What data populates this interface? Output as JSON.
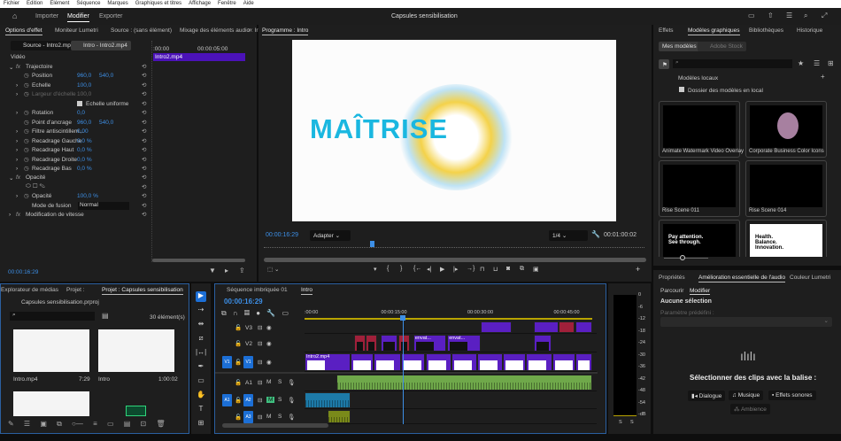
{
  "menu": [
    "Fichier",
    "Edition",
    "Elément",
    "Séquence",
    "Marques",
    "Graphiques et titres",
    "Affichage",
    "Fenêtre",
    "Aide"
  ],
  "header": {
    "home_icon": "home-icon",
    "workspaces": [
      "Importer",
      "Modifier",
      "Exporter"
    ],
    "active": "Modifier",
    "title": "Capsules sensibilisation",
    "right_icons": [
      "workspace-panel-icon",
      "share-icon",
      "menu-icon",
      "search-icon",
      "fullscreen-icon"
    ]
  },
  "effects": {
    "tabs": [
      "Options d'effet",
      "Moniteur Lumetri",
      "Source : (sans élément)",
      "Mixage des éléments audio : Ir"
    ],
    "source_tab": "Source - Intro2.mp4",
    "seq_tab": "Intro - Intro2.mp4",
    "section": "Vidéo",
    "ruler": [
      ":00:00",
      "00:00:05:00"
    ],
    "clip": "Intro2.mp4",
    "rows": [
      {
        "label": "Trajectoire",
        "fx": true,
        "open": true,
        "v": []
      },
      {
        "label": "Position",
        "sw": true,
        "v": [
          "960,0",
          "540,0"
        ]
      },
      {
        "label": "Echelle",
        "sw": true,
        "exp": true,
        "v": [
          "100,0"
        ]
      },
      {
        "label": "Largeur d'échelle",
        "sw": true,
        "exp": true,
        "dis": true,
        "v": [
          "100,0"
        ]
      },
      {
        "label": "Echelle uniforme",
        "check": true,
        "v": []
      },
      {
        "label": "Rotation",
        "sw": true,
        "exp": true,
        "v": [
          "0,0"
        ]
      },
      {
        "label": "Point d'ancrage",
        "sw": true,
        "v": [
          "960,0",
          "540,0"
        ]
      },
      {
        "label": "Filtre antiscintillem...",
        "sw": true,
        "exp": true,
        "v": [
          "0,00"
        ]
      },
      {
        "label": "Recadrage Gauche",
        "sw": true,
        "exp": true,
        "v": [
          "0,0 %"
        ]
      },
      {
        "label": "Recadrage Haut",
        "sw": true,
        "exp": true,
        "v": [
          "0,0 %"
        ]
      },
      {
        "label": "Recadrage Droite",
        "sw": true,
        "exp": true,
        "v": [
          "0,0 %"
        ]
      },
      {
        "label": "Recadrage Bas",
        "sw": true,
        "exp": true,
        "v": [
          "0,0 %"
        ]
      },
      {
        "label": "Opacité",
        "fx": true,
        "open": true,
        "v": []
      },
      {
        "label": "",
        "masks": true,
        "v": []
      },
      {
        "label": "Opacité",
        "sw": true,
        "exp": true,
        "v": [
          "100,0 %"
        ]
      },
      {
        "label": "Mode de fusion",
        "select": "Normal",
        "v": []
      },
      {
        "label": "Modification de vitesse",
        "fx": true,
        "v": []
      }
    ],
    "timecode": "00:00:16:29"
  },
  "program": {
    "tab": "Programme : Intro",
    "title_text": "MAÎTRISE",
    "title_color": "#1ab7e0",
    "timecode": "00:00:16:29",
    "fit": "Adapter",
    "resolution": "1/4",
    "duration": "00:01:00:02",
    "playhead_fraction": 0.28,
    "buttons": [
      "marker-icon",
      "mark-in-icon",
      "mark-out-icon",
      "go-to-in-icon",
      "step-back-icon",
      "play-icon",
      "step-forward-icon",
      "go-to-out-icon",
      "insert-icon",
      "overwrite-icon",
      "export-frame-icon",
      "compare-icon",
      "proxy-icon"
    ]
  },
  "graphics": {
    "tabs": [
      "Effets",
      "Modèles graphiques",
      "Bibliothèques",
      "Historique"
    ],
    "sub": [
      "Mes modèles",
      "Adobe Stock"
    ],
    "local": "Modèles locaux",
    "folder": "Dossier des modèles en local",
    "cards": [
      {
        "label": "Animate Watermark Video Overlay"
      },
      {
        "label": "Corporate Business Color Icons"
      },
      {
        "label": "Rise Scene 011"
      },
      {
        "label": "Rise Scene 014"
      },
      {
        "label": "",
        "text": "Pay attention. See through."
      },
      {
        "label": "",
        "text": "Health. Balance. Innovation."
      }
    ]
  },
  "project": {
    "tabs": [
      "Explorateur de médias",
      "Projet :",
      "Projet : Capsules sensibilisation"
    ],
    "file": "Capsules sensibilisation.prproj",
    "count": "30 élément(s)",
    "items": [
      {
        "name": "Intro.mp4",
        "dur": "7:29"
      },
      {
        "name": "Intro",
        "dur": "1:00:02"
      }
    ]
  },
  "timeline": {
    "tabs": [
      "Séquence imbriquée 01",
      "Intro"
    ],
    "timecode": "00:00:16:29",
    "ruler": [
      ":00:00",
      "00:00:15:00",
      "00:00:30:00",
      "00:00:45:00"
    ],
    "playhead_s": 17,
    "tracks": [
      "V3",
      "V2",
      "V1",
      "A1",
      "A2",
      "A3"
    ],
    "clips": {
      "V3": [
        {
          "s": 30.6,
          "e": 36,
          "c": "#5a1fc2"
        },
        {
          "s": 39.8,
          "e": 44.2,
          "c": "#5a1fc2"
        },
        {
          "s": 44.2,
          "e": 47,
          "c": "#a0203a"
        },
        {
          "s": 47,
          "e": 50,
          "c": "#5a1fc2"
        }
      ],
      "V2": [
        {
          "s": 8.6,
          "e": 10.6,
          "c": "#a0203a"
        },
        {
          "s": 10.6,
          "e": 12.6,
          "c": "#a0203a"
        },
        {
          "s": 13.2,
          "e": 16.2,
          "c": "#5a1fc2"
        },
        {
          "s": 16.3,
          "e": 18.3,
          "c": "#a0203a"
        },
        {
          "s": 18.9,
          "e": 24.6,
          "c": "#5a1fc2",
          "n": "envat..."
        },
        {
          "s": 24.8,
          "e": 30.6,
          "c": "#5a1fc2",
          "n": "envat..."
        },
        {
          "s": 39.8,
          "e": 43,
          "c": "#5a1fc2"
        }
      ],
      "V1": [
        {
          "s": 0,
          "e": 8,
          "c": "#5a1fc2",
          "n": "Intro2.mp4"
        },
        {
          "s": 8,
          "e": 12,
          "c": "#5a1fc2"
        },
        {
          "s": 12,
          "e": 16.8,
          "c": "#5a1fc2"
        },
        {
          "s": 16.8,
          "e": 21,
          "c": "#5a1fc2"
        },
        {
          "s": 21,
          "e": 25.5,
          "c": "#5a1fc2"
        },
        {
          "s": 25.5,
          "e": 30,
          "c": "#5a1fc2"
        },
        {
          "s": 30,
          "e": 34.5,
          "c": "#5a1fc2"
        },
        {
          "s": 34.5,
          "e": 38.5,
          "c": "#5a1fc2"
        },
        {
          "s": 38.5,
          "e": 43,
          "c": "#5a1fc2"
        },
        {
          "s": 43,
          "e": 47,
          "c": "#5a1fc2"
        },
        {
          "s": 47,
          "e": 50,
          "c": "#5a1fc2"
        }
      ],
      "A1": [
        {
          "s": 5.5,
          "e": 50,
          "c": "#6fa84a"
        }
      ],
      "A2": [
        {
          "s": 0,
          "e": 8,
          "c": "#1d7aa8"
        }
      ],
      "A3": [
        {
          "s": 4,
          "e": 8,
          "c": "#7a8a1a"
        }
      ]
    }
  },
  "meter": {
    "scale": [
      "0",
      "-6",
      "-12",
      "-18",
      "-24",
      "-30",
      "-36",
      "-42",
      "-48",
      "-54",
      "-dB"
    ],
    "solo": [
      "S",
      "S"
    ]
  },
  "audio": {
    "tabs": [
      "Propriétés",
      "Amélioration essentielle de l'audio",
      "Couleur Lumetri"
    ],
    "sub": [
      "Parcourir",
      "Modifier"
    ],
    "none": "Aucune sélection",
    "preset": "Paramètre prédéfini :",
    "prompt": "Sélectionner des clips avec la balise :",
    "buttons": [
      "Dialogue",
      "Musique",
      "Effets sonores",
      "Ambience"
    ]
  },
  "tools": [
    "selection-tool-icon",
    "track-select-icon",
    "ripple-edit-icon",
    "razor-icon",
    "slip-icon",
    "pen-icon",
    "rectangle-icon",
    "hand-icon",
    "type-icon",
    "caption-icon"
  ]
}
